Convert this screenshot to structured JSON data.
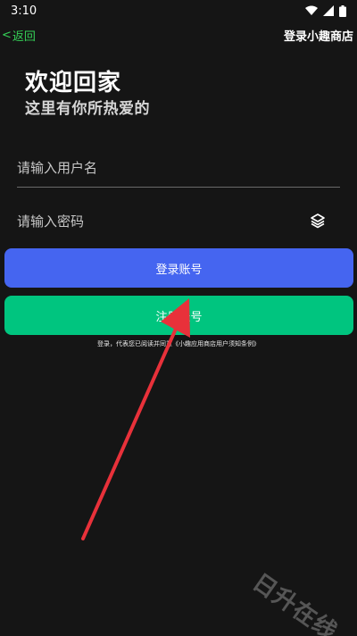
{
  "status_bar": {
    "time": "3:10",
    "icons": [
      "wifi-icon",
      "signal-icon",
      "battery-icon"
    ]
  },
  "nav": {
    "back_label": "返回",
    "title": "登录小趣商店"
  },
  "welcome": {
    "title": "欢迎回家",
    "subtitle": "这里有你所热爱的"
  },
  "form": {
    "username_placeholder": "请输入用户名",
    "password_placeholder": "请输入密码"
  },
  "buttons": {
    "login_label": "登录账号",
    "register_label": "注册账号"
  },
  "agreement_text": "登录，代表您已阅读并同意《小趣应用商店用户须知条例》",
  "watermark": "日升在线",
  "colors": {
    "background": "#151515",
    "back_link": "#35d157",
    "login_button": "#4565f0",
    "register_button": "#00c57f",
    "arrow": "#e8313a"
  }
}
